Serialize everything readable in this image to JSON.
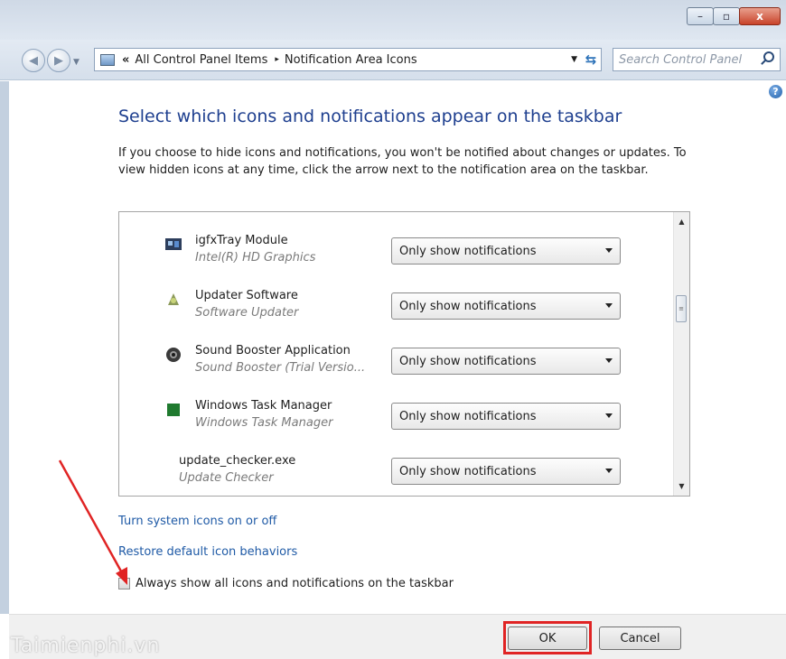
{
  "window": {
    "caption_buttons": {
      "minimize": "–",
      "maximize": "▫",
      "close": "x"
    }
  },
  "navigation": {
    "back_icon": "back-arrow-icon",
    "forward_icon": "forward-arrow-icon",
    "breadcrumb": {
      "chevron": "«",
      "items": [
        "All Control Panel Items",
        "Notification Area Icons"
      ],
      "separator": "▸"
    },
    "refresh_icon": "refresh-icon",
    "search_placeholder": "Search Control Panel"
  },
  "main": {
    "heading": "Select which icons and notifications appear on the taskbar",
    "description": "If you choose to hide icons and notifications, you won't be notified about changes or updates. To view hidden icons at any time, click the arrow next to the notification area on the taskbar.",
    "items": [
      {
        "name": "igfxTray Module",
        "sub": "Intel(R) HD Graphics",
        "behavior": "Only show notifications",
        "icon": "intel-graphics-icon"
      },
      {
        "name": "Updater Software",
        "sub": "Software Updater",
        "behavior": "Only show notifications",
        "icon": "updater-icon"
      },
      {
        "name": "Sound Booster Application",
        "sub": "Sound Booster (Trial Versio...",
        "behavior": "Only show notifications",
        "icon": "sound-booster-icon"
      },
      {
        "name": "Windows Task Manager",
        "sub": "Windows Task Manager",
        "behavior": "Only show notifications",
        "icon": "task-manager-icon"
      },
      {
        "name": "update_checker.exe",
        "sub": "Update Checker",
        "behavior": "Only show notifications",
        "icon": ""
      }
    ],
    "scroll_thumb_label": "≡",
    "links": {
      "system_icons": "Turn system icons on or off",
      "restore_defaults": "Restore default icon behaviors"
    },
    "always_show_label": "Always show all icons and notifications on the taskbar",
    "always_show_checked": false
  },
  "footer": {
    "ok_label": "OK",
    "cancel_label": "Cancel",
    "watermark": "Taimienphi.vn"
  },
  "colors": {
    "heading": "#1e3f8f",
    "link": "#1f5aa6",
    "annotation": "#e02424"
  }
}
